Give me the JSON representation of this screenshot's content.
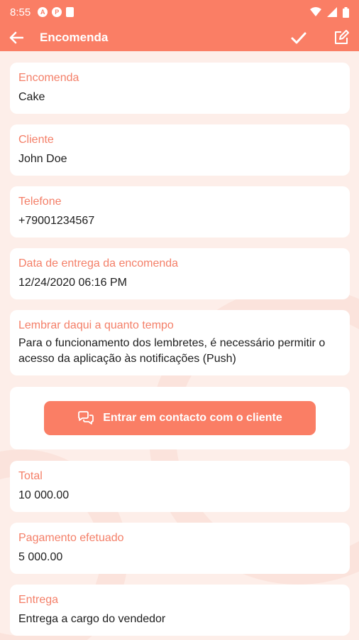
{
  "status_bar": {
    "time": "8:55",
    "notif_icon_1": "A",
    "notif_icon_2": "P"
  },
  "app_bar": {
    "title": "Encomenda",
    "icons": [
      "arrow-back-icon",
      "check-icon",
      "edit-icon"
    ]
  },
  "colors": {
    "accent": "#fa7e65",
    "label": "#f47f68",
    "background": "#fdeee9"
  },
  "fields": [
    {
      "label": "Encomenda",
      "value": "Cake"
    },
    {
      "label": "Cliente",
      "value": "John Doe"
    },
    {
      "label": "Telefone",
      "value": "+79001234567"
    },
    {
      "label": "Data de entrega da encomenda",
      "value": "12/24/2020 06:16 PM"
    },
    {
      "label": "Lembrar daqui a quanto tempo",
      "value": "Para o funcionamento dos lembretes, é necessário permitir o acesso da aplicação às notificações (Push)"
    },
    {
      "label": "Total",
      "value": "10 000.00"
    },
    {
      "label": "Pagamento efetuado",
      "value": "5 000.00"
    },
    {
      "label": "Entrega",
      "value": "Entrega a cargo do vendedor"
    }
  ],
  "contact_button": {
    "label": "Entrar em contacto com o cliente",
    "icon": "chat-icon"
  }
}
